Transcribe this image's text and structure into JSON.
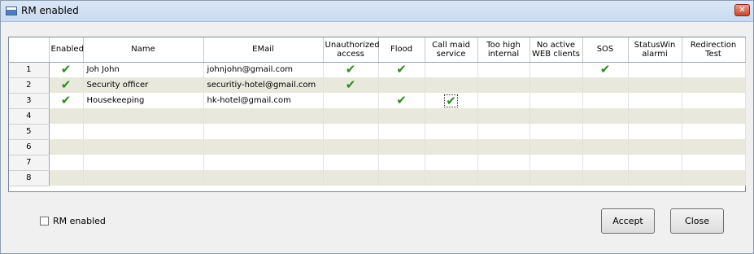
{
  "window": {
    "title": "RM enabled",
    "close_glyph": "✕"
  },
  "grid": {
    "columns": [
      "",
      "Enabled",
      "Name",
      "EMail",
      "Unauthorized access",
      "Flood",
      "Call maid service",
      "Too high internal",
      "No active WEB clients",
      "SOS",
      "StatusWin alarmi",
      "Redirection Test"
    ],
    "rows": [
      {
        "num": "1",
        "name": "Joh John",
        "email": "johnjohn@gmail.com",
        "enabled": true,
        "unauthorized": true,
        "flood": true,
        "call_maid": false,
        "too_high": false,
        "no_web": false,
        "sos": true,
        "statuswin": false,
        "redirection": false
      },
      {
        "num": "2",
        "name": "Security officer",
        "email": "securitiy-hotel@gmail.com",
        "enabled": true,
        "unauthorized": true,
        "flood": false,
        "call_maid": false,
        "too_high": false,
        "no_web": false,
        "sos": false,
        "statuswin": false,
        "redirection": false
      },
      {
        "num": "3",
        "name": "Housekeeping",
        "email": "hk-hotel@gmail.com",
        "enabled": true,
        "unauthorized": false,
        "flood": true,
        "call_maid": true,
        "too_high": false,
        "no_web": false,
        "sos": false,
        "statuswin": false,
        "redirection": false
      },
      {
        "num": "4",
        "name": "",
        "email": ""
      },
      {
        "num": "5",
        "name": "",
        "email": ""
      },
      {
        "num": "6",
        "name": "",
        "email": ""
      },
      {
        "num": "7",
        "name": "",
        "email": ""
      },
      {
        "num": "8",
        "name": "",
        "email": ""
      }
    ],
    "check_glyph": "✔",
    "check_color": "#2f8a1f",
    "alt_row_color": "#e8e8dc"
  },
  "footer": {
    "rm_enabled_label": "RM enabled",
    "rm_enabled_checked": false,
    "accept_label": "Accept",
    "close_label": "Close"
  }
}
